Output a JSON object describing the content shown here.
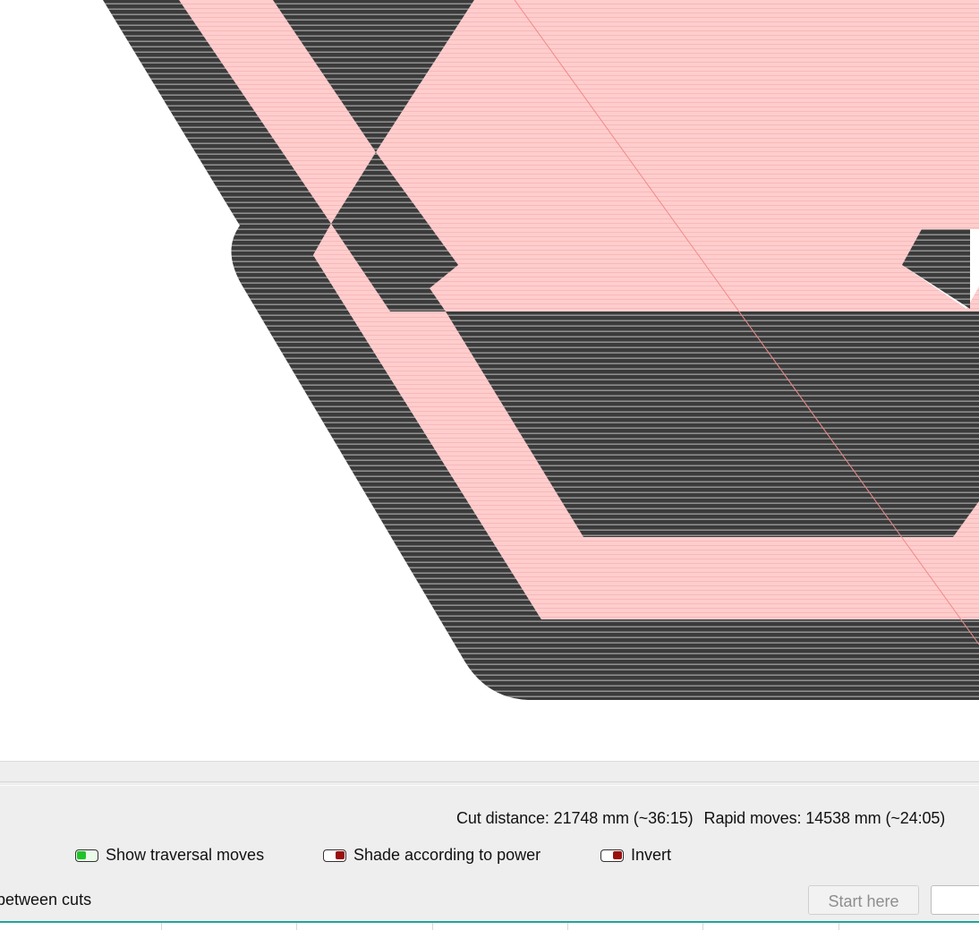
{
  "preview": {
    "cut_color": "#ffcccc",
    "raster_color": "#3a3a3a"
  },
  "stats": {
    "cut_distance": "Cut distance: 21748 mm (~36:15)",
    "rapid_moves": "Rapid moves: 14538 mm (~24:05)"
  },
  "options": {
    "show_traversal": {
      "label": "Show traversal moves",
      "state": "on"
    },
    "shade_power": {
      "label": "Shade according to power",
      "state": "off"
    },
    "invert": {
      "label": "Invert",
      "state": "off"
    }
  },
  "bottom": {
    "cut_label": "between cuts",
    "start_here": "Start here"
  }
}
